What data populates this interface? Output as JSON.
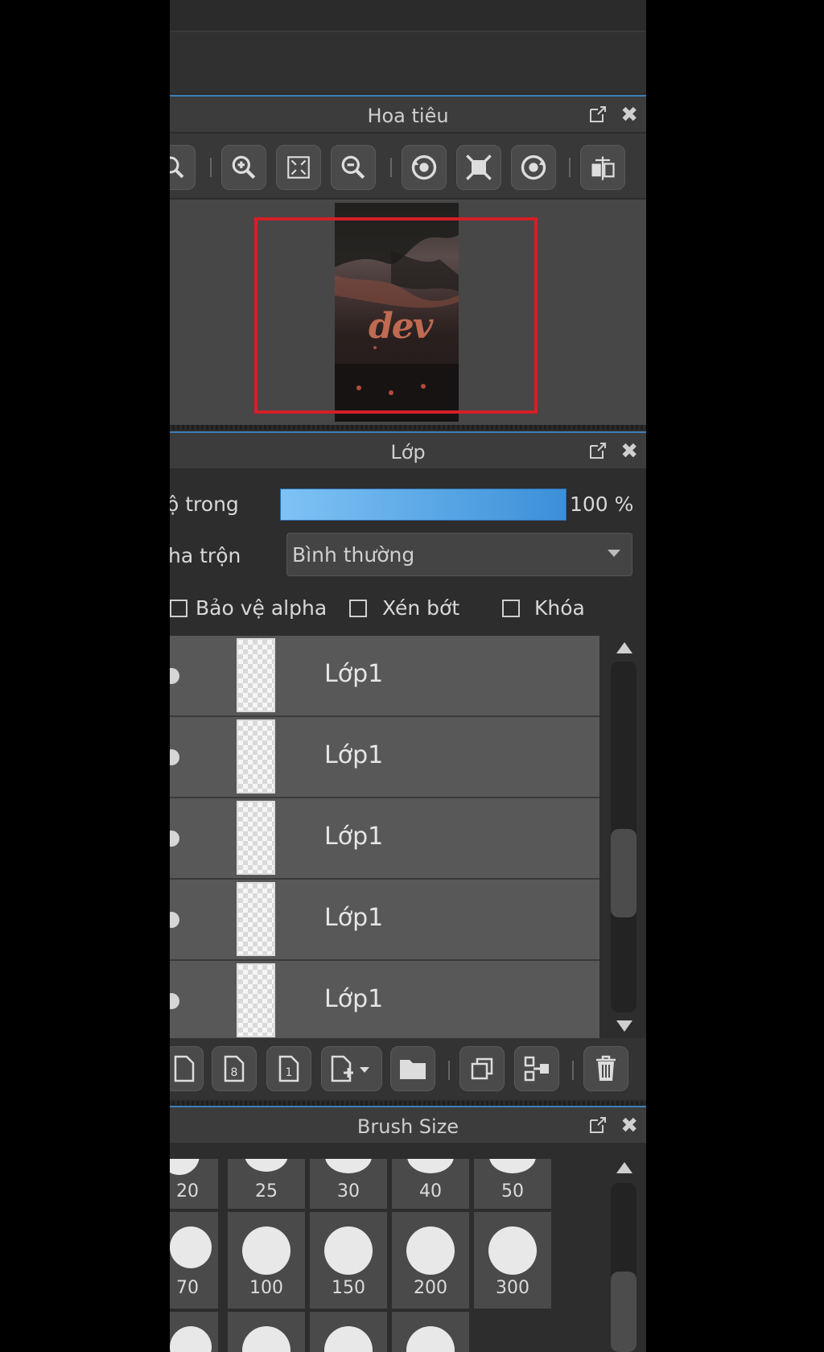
{
  "navigator": {
    "title": "Hoa tiêu",
    "thumb_text": "dev"
  },
  "layers_panel": {
    "title": "Lớp",
    "opacity_label": "ộ trong",
    "opacity_value": "100 %",
    "opacity_fraction": 1.0,
    "blend_label": "ha trộn",
    "blend_value": "Bình thường",
    "checkboxes": [
      {
        "label": "Bảo vệ alpha",
        "checked": false
      },
      {
        "label": "Xén bớt",
        "checked": false
      },
      {
        "label": "Khóa",
        "checked": false
      }
    ],
    "layers": [
      {
        "name": "Lớp1"
      },
      {
        "name": "Lớp1"
      },
      {
        "name": "Lớp1"
      },
      {
        "name": "Lớp1"
      },
      {
        "name": "Lớp1"
      }
    ]
  },
  "brush_panel": {
    "title": "Brush Size",
    "sizes_row1": [
      "20",
      "25",
      "30",
      "40",
      "50"
    ],
    "sizes_row2": [
      "70",
      "100",
      "150",
      "200",
      "300"
    ]
  },
  "colors": {
    "accent": "#3d7fb7",
    "view_rect": "#d41f26",
    "opacity_bar": "#5aa8ea"
  },
  "icons": {
    "navigator_toolbar": [
      "zoom-icon",
      "zoom-in-icon",
      "fit-icon",
      "zoom-out-icon",
      "rotate-left-icon",
      "actual-size-icon",
      "rotate-right-icon",
      "flip-icon"
    ],
    "layer_toolbar": [
      "new-layer-icon",
      "new-8bit-layer-icon",
      "new-1bit-layer-icon",
      "add-layer-menu-icon",
      "folder-icon",
      "duplicate-icon",
      "merge-icon",
      "delete-icon"
    ]
  }
}
